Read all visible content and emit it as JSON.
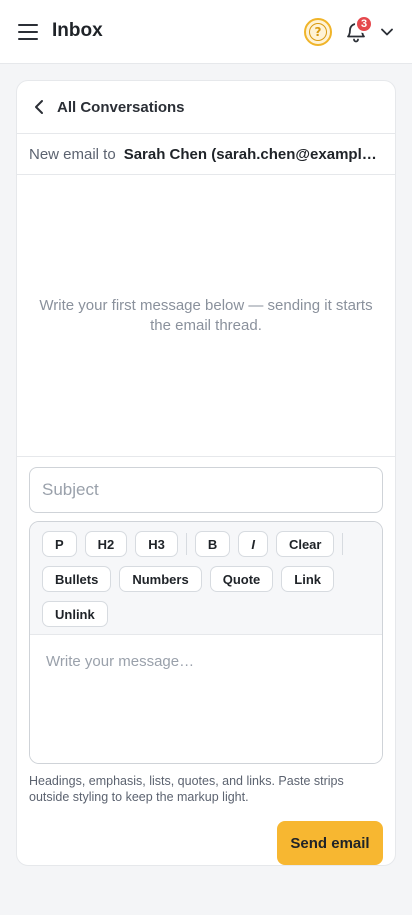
{
  "topbar": {
    "title": "Inbox",
    "help_icon": "question-circle-icon",
    "notifications": {
      "icon": "bell-icon",
      "count": "3"
    },
    "user_menu_icon": "chevron-down-icon"
  },
  "conversation": {
    "back_label": "All Conversations",
    "recipient_label": "New email to",
    "recipient_value": "Sarah Chen (sarah.chen@example.com)",
    "empty_message": "Write your first message below — sending it starts the email thread."
  },
  "composer": {
    "subject_placeholder": "Subject",
    "toolbar": {
      "p": "P",
      "h2": "H2",
      "h3": "H3",
      "bold": "B",
      "italic": "I",
      "clear": "Clear",
      "bullets": "Bullets",
      "numbers": "Numbers",
      "quote": "Quote",
      "link": "Link",
      "unlink": "Unlink"
    },
    "message_placeholder": "Write your message…",
    "hint": "Headings, emphasis, lists, quotes, and links. Paste strips outside styling to keep the markup light.",
    "send_label": "Send email"
  },
  "colors": {
    "accent": "#f7b731",
    "badge": "#e5484d",
    "help": "#f0b429"
  }
}
